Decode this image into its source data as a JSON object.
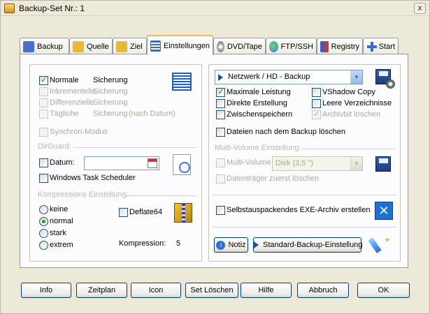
{
  "window": {
    "title": "Backup-Set Nr.: 1",
    "close_glyph": "x"
  },
  "tabs": [
    {
      "label": "Backup",
      "icon": "backup-icon",
      "color": "#4a6fd0"
    },
    {
      "label": "Quelle",
      "icon": "source-folder-icon",
      "color": "#e8b83a"
    },
    {
      "label": "Ziel",
      "icon": "target-folder-icon",
      "color": "#e8b83a"
    },
    {
      "label": "Einstellungen",
      "icon": "settings-list-icon",
      "color": "#3a6bc9",
      "active": true
    },
    {
      "label": "DVD/Tape",
      "icon": "dvd-icon",
      "color": "#8a8a8a"
    },
    {
      "label": "FTP/SSH",
      "icon": "globe-icon",
      "color": "#2a8bd2"
    },
    {
      "label": "Registry",
      "icon": "registry-icon",
      "color": "#c03a3a"
    },
    {
      "label": "Start",
      "icon": "plus-icon",
      "color": "#2b6fd6"
    }
  ],
  "left": {
    "backup_types": [
      {
        "label": "Normale",
        "label2": "Sicherung",
        "extra": "",
        "checked": true,
        "disabled": false
      },
      {
        "label": "Inkrementelle",
        "label2": "Sicherung",
        "extra": "",
        "checked": false,
        "disabled": true
      },
      {
        "label": "Differenzielle",
        "label2": "Sicherung",
        "extra": "",
        "checked": false,
        "disabled": true
      },
      {
        "label": "Tägliche",
        "label2": "Sicherung",
        "extra": "(nach Datum)",
        "checked": false,
        "disabled": true
      }
    ],
    "synchron": "Synchron-Modus",
    "dirguard": {
      "group_label": "DirGuard:",
      "datum_label": "Datum:",
      "datum_value": "",
      "scheduler_label": "Windows Task Scheduler"
    },
    "compression": {
      "group_label": "Kompressions Einstellung:",
      "options": [
        "keine",
        "normal",
        "stark",
        "extrem"
      ],
      "selected": "normal",
      "deflate_label": "Deflate64",
      "level_label": "Kompression:",
      "level_value": "5"
    }
  },
  "right": {
    "target_type": "Netzwerk / HD - Backup",
    "options": [
      {
        "label": "Maximale Leistung",
        "checked": true,
        "disabled": false
      },
      {
        "label": "VShadow Copy",
        "checked": false,
        "disabled": false
      },
      {
        "label": "Direkte Erstellung",
        "checked": false,
        "disabled": false
      },
      {
        "label": "Leere Verzeichnisse",
        "checked": false,
        "disabled": false
      },
      {
        "label": "Zwischenspeichern",
        "checked": false,
        "disabled": false
      },
      {
        "label": "Archivbit löschen",
        "checked": true,
        "disabled": true
      }
    ],
    "delete_after": "Dateien nach dem Backup löschen",
    "multivolume": {
      "group_label": "Multi-Volume  Einstellung:",
      "label": "Multi-Volume",
      "size_value": "Disk (3,5 \")",
      "delete_first": "Datenträger zuerst löschen"
    },
    "sfx_label": "Selbstauspackendes EXE-Archiv erstellen",
    "notiz_label": "Notiz",
    "std_settings_label": "Standard-Backup-Einstellung"
  },
  "footer": {
    "buttons": [
      "Info",
      "Zeitplan",
      "Icon",
      "Set Löschen",
      "Hilfe",
      "Abbruch",
      "OK"
    ]
  },
  "colors": {
    "accent": "#f5b94c",
    "check": "#21a121",
    "border": "#003c74"
  }
}
